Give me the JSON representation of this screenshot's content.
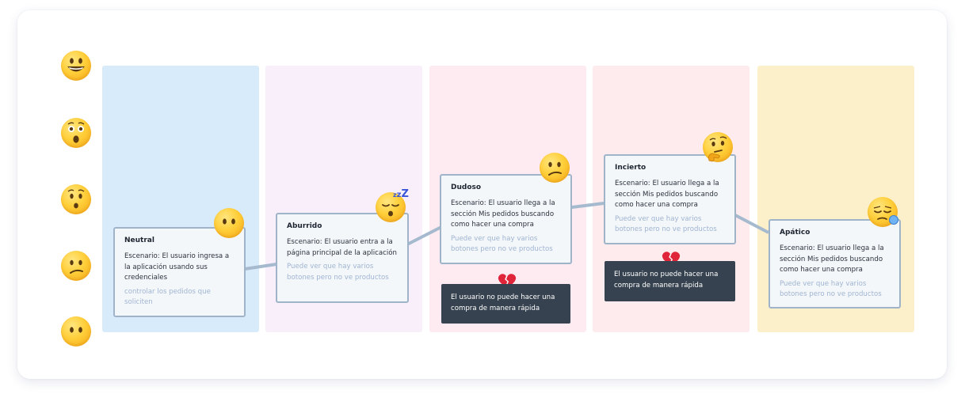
{
  "lane_colors": [
    "#d8ebfb",
    "#f8effb",
    "#fdebf1",
    "#fdebed",
    "#fcf0cb"
  ],
  "axis_emojis": [
    "grinning-face-icon",
    "astonished-face-icon",
    "hushed-face-icon",
    "confused-face-icon",
    "face-without-mouth-icon"
  ],
  "cards": [
    {
      "emotion": "Neutral",
      "scenario": "Escenario: El usuario ingresa a la aplicación usando sus credenciales",
      "hint": "controlar los pedidos que soliciten",
      "emoji": "face-without-mouth-icon"
    },
    {
      "emotion": "Aburrido",
      "scenario": "Escenario: El usuario entra a la página principal de la aplicación",
      "hint": "Puede ver que hay varios botones pero no ve productos",
      "emoji": "sleeping-face-icon"
    },
    {
      "emotion": "Dudoso",
      "scenario": "Escenario: El usuario llega a la sección Mis pedidos buscando como hacer una compra",
      "hint": "Puede ver que hay varios botones pero no ve productos",
      "emoji": "confused-face-icon"
    },
    {
      "emotion": "Incierto",
      "scenario": "Escenario: El usuario llega a la sección Mis pedidos buscando como hacer una compra",
      "hint": "Puede ver que hay varios botones pero no ve productos",
      "emoji": "thinking-face-icon"
    },
    {
      "emotion": "Apático",
      "scenario": "Escenario: El usuario llega a la sección Mis pedidos buscando como hacer una compra",
      "hint": "Puede ver que hay varios botones pero no ve productos",
      "emoji": "sleepy-face-icon"
    }
  ],
  "pain_points": [
    {
      "text": "El usuario no puede hacer una compra de manera rápida",
      "icon": "broken-heart-icon"
    },
    {
      "text": "El usuario no puede hacer una compra de manera rápida",
      "icon": "broken-heart-icon"
    }
  ],
  "connector_color": "#a5bace"
}
